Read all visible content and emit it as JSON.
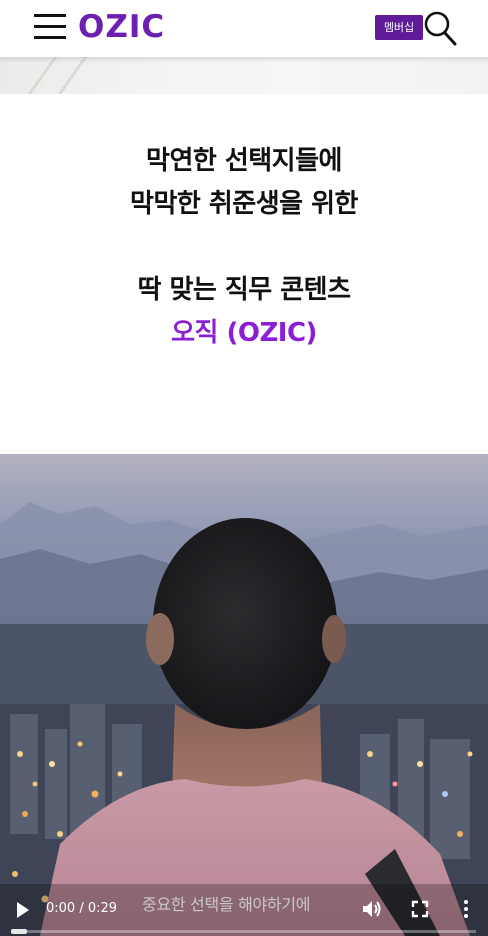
{
  "header": {
    "logo": "OZIC",
    "member_badge": "멤버십",
    "menu_icon": "hamburger-menu-icon",
    "search_icon": "search-icon"
  },
  "intro": {
    "line1": "막연한 선택지들에",
    "line2": "막막한 취준생을 위한",
    "line3": "딱 맞는 직무 콘텐츠",
    "line4": "오직 (OZIC)"
  },
  "video": {
    "time": "0:00 / 0:29",
    "subtitle": "중요한 선택을 해야하기에",
    "progress": 0,
    "icons": [
      "play-icon",
      "volume-icon",
      "fullscreen-icon",
      "more-options-icon"
    ]
  },
  "colors": {
    "brand": "#6d1fb0",
    "brand_text": "#8a1fd6",
    "badge_bg": "#5f1b98"
  }
}
